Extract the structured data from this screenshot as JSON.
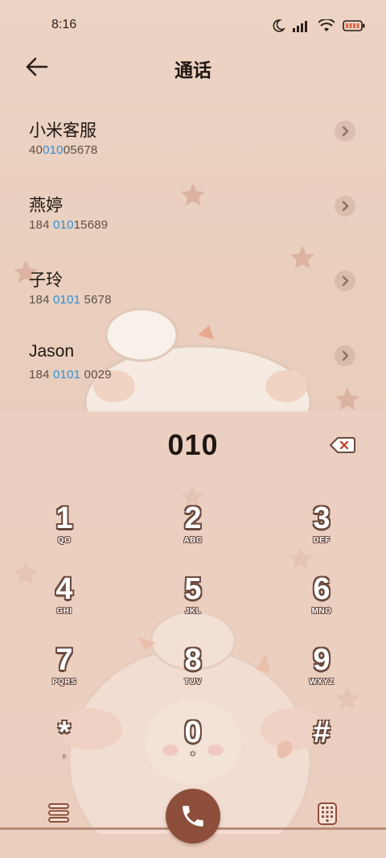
{
  "status_bar": {
    "time": "8:16"
  },
  "header": {
    "title": "通话"
  },
  "contacts": [
    {
      "name": "小米客服",
      "number_pre": "40",
      "number_match": "010",
      "number_post": "05678"
    },
    {
      "name": "燕婷",
      "number_pre": "184 ",
      "number_match": "010",
      "number_post": "15689"
    },
    {
      "name": "子玲",
      "number_pre": "184 ",
      "number_match": "0101",
      "number_post": " 5678"
    },
    {
      "name": "Jason",
      "number_pre": "184 ",
      "number_match": "0101",
      "number_post": " 0029"
    }
  ],
  "dialer": {
    "typed_number": "010"
  },
  "keypad": [
    {
      "digit": "1",
      "letters": "QO"
    },
    {
      "digit": "2",
      "letters": "ABC"
    },
    {
      "digit": "3",
      "letters": "DEF"
    },
    {
      "digit": "4",
      "letters": "GHI"
    },
    {
      "digit": "5",
      "letters": "JKL"
    },
    {
      "digit": "6",
      "letters": "MNO"
    },
    {
      "digit": "7",
      "letters": "PQRS"
    },
    {
      "digit": "8",
      "letters": "TUV"
    },
    {
      "digit": "9",
      "letters": "WXYZ"
    },
    {
      "digit": "*",
      "letters": ","
    },
    {
      "digit": "0",
      "letters": "+"
    },
    {
      "digit": "#",
      "letters": ""
    }
  ],
  "colors": {
    "background": "#e9cdbc",
    "highlight": "#2e8fd8",
    "call_button": "#8d4f3c",
    "key_outline": "#6a4a3e"
  },
  "icons": {
    "back": "arrow-left-icon",
    "row_action": "chevron-right-icon",
    "backspace": "backspace-icon",
    "menu": "menu-icon",
    "call": "phone-icon",
    "keypad_toggle": "dialpad-icon"
  }
}
